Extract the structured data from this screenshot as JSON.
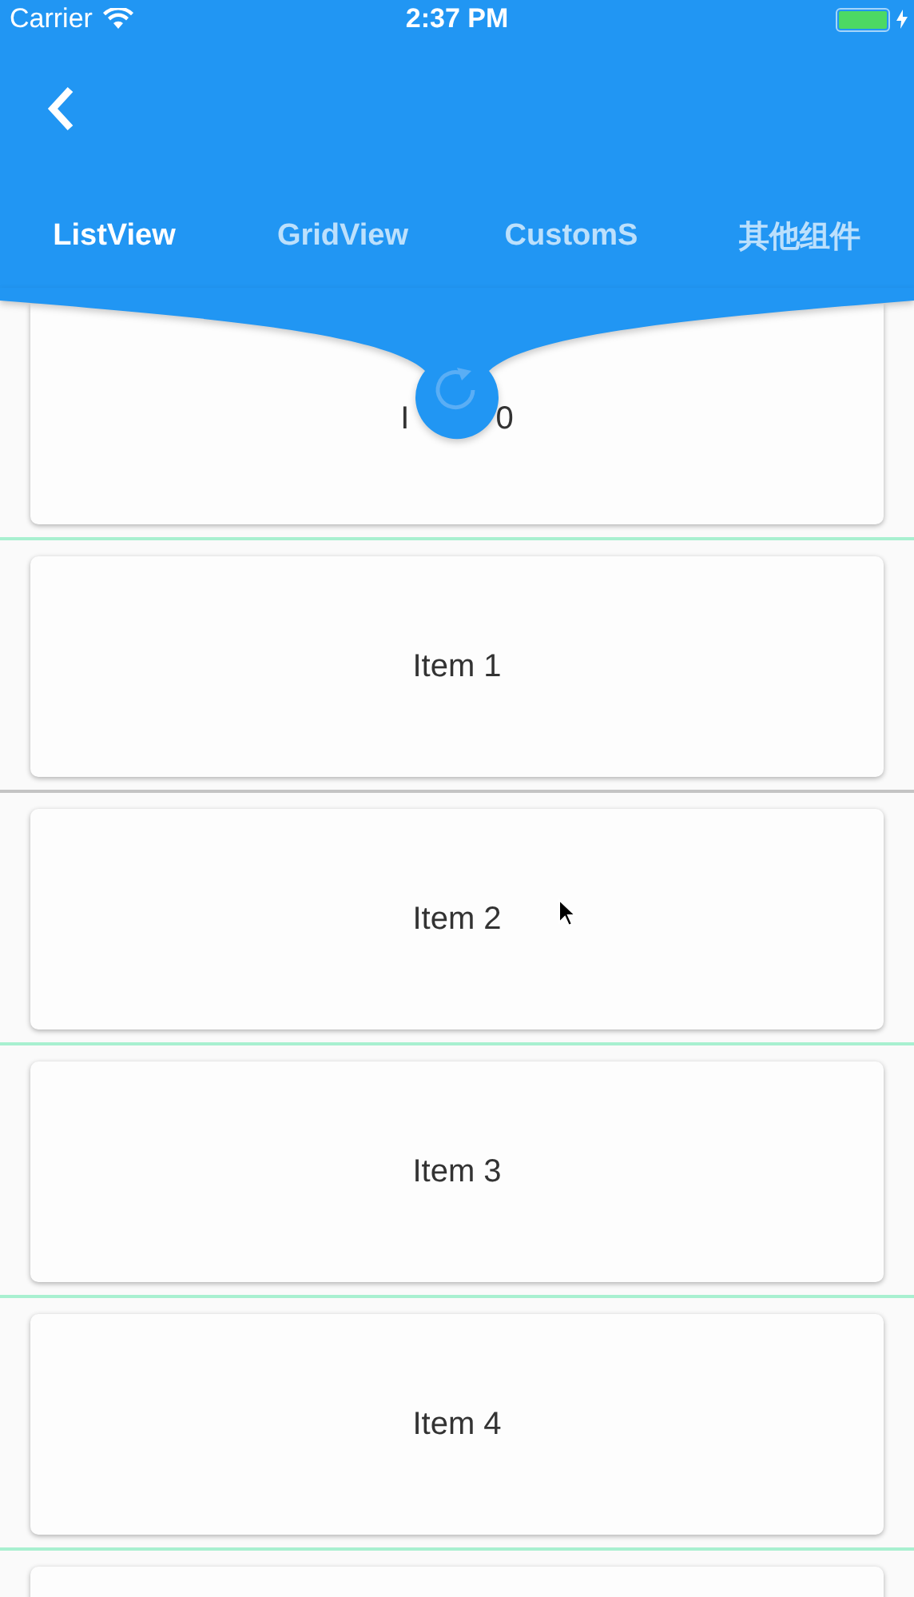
{
  "status_bar": {
    "carrier": "Carrier",
    "time": "2:37 PM",
    "battery": {
      "level": 1.0,
      "charging": true
    }
  },
  "tabs": [
    {
      "label": "ListView",
      "selected": true
    },
    {
      "label": "GridView",
      "selected": false
    },
    {
      "label": "CustomS",
      "selected": false
    },
    {
      "label": "其他组件",
      "selected": false
    }
  ],
  "refresh": {
    "pulling": true
  },
  "items": [
    {
      "label_parts": [
        "I",
        "0"
      ],
      "color": "#a8f0d0"
    },
    {
      "label": "Item 1",
      "color": "#c4c4c4"
    },
    {
      "label": "Item 2",
      "color": "#a8f0d0"
    },
    {
      "label": "Item 3",
      "color": "#a8f0d0"
    },
    {
      "label": "Item 4",
      "color": "#a8f0d0"
    }
  ],
  "more_below": true
}
